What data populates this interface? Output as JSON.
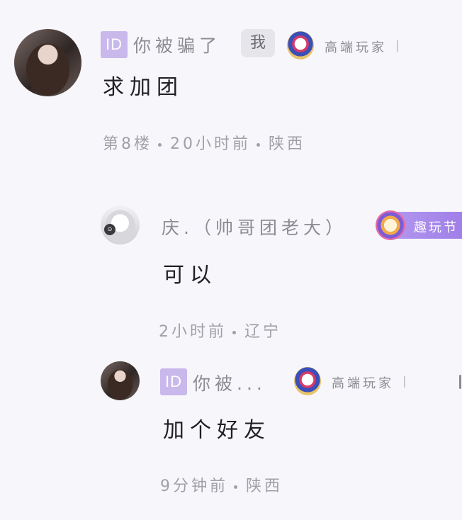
{
  "comments": [
    {
      "author": "你被骗了",
      "id_badge": "ID",
      "me_badge": "我",
      "rank_icon": "medal-icon",
      "rank_label": "高端玩家",
      "rank_sep": "|",
      "content": "求加团",
      "floor": "第8楼",
      "time": "20小时前",
      "location": "陕西"
    }
  ],
  "replies": [
    {
      "author": "庆.（帅哥团老大）",
      "event_icon": "event-character-icon",
      "event_label": "趣玩节",
      "content": "可以",
      "time": "2小时前",
      "location": "辽宁"
    },
    {
      "author": "你被...",
      "id_badge": "ID",
      "rank_icon": "medal-icon",
      "rank_label": "高端玩家",
      "rank_sep": "|",
      "content": "加个好友",
      "time": "9分钟前",
      "location": "陕西"
    }
  ],
  "colors": {
    "background": "#f7f6fa",
    "id_badge": "#c8b8ec",
    "event_tag": "#a98bec",
    "text_primary": "#202024",
    "text_secondary": "#8c8c94"
  }
}
